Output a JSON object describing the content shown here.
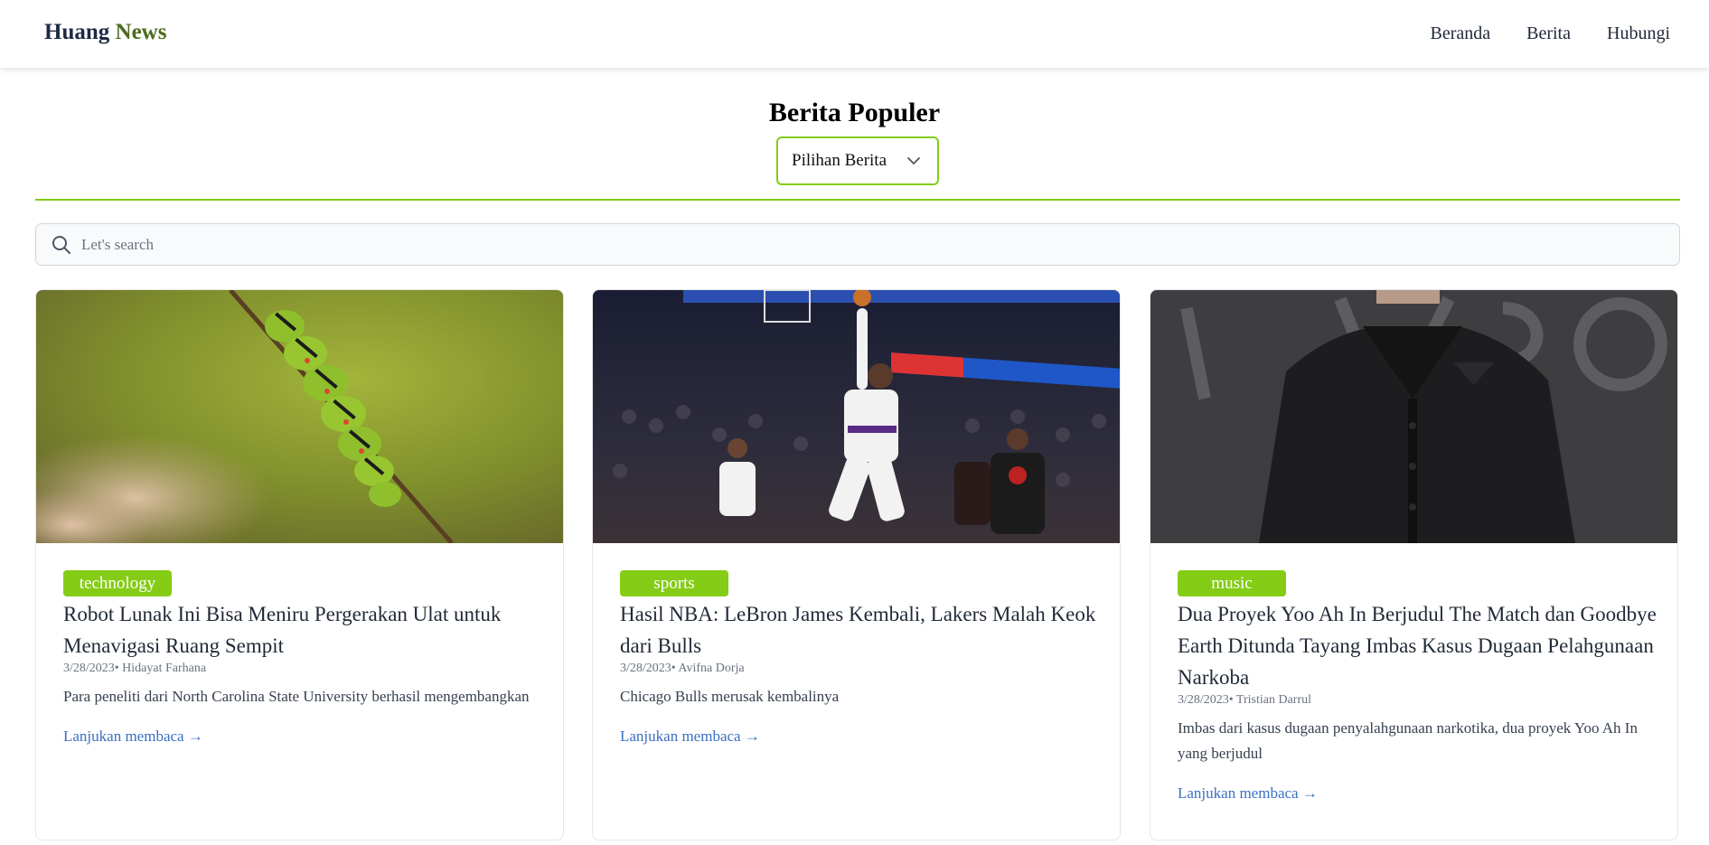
{
  "header": {
    "brand_first": "Huang",
    "brand_second": "News",
    "nav": [
      "Beranda",
      "Berita",
      "Hubungi"
    ]
  },
  "main": {
    "title": "Berita Populer",
    "filter": {
      "selected": "Pilihan Berita"
    },
    "search": {
      "placeholder": "Let's search",
      "value": ""
    }
  },
  "articles": [
    {
      "category": "technology",
      "title": "Robot Lunak Ini Bisa Meniru Pergerakan Ulat untuk Menavigasi Ruang Sempit",
      "meta": "3/28/2023• Hidayat Farhana",
      "excerpt": "Para peneliti dari North Carolina State University berhasil mengembangkan",
      "link": "Lanjukan membaca →",
      "image": "caterpillar-photo"
    },
    {
      "category": "sports",
      "title": "Hasil NBA: LeBron James Kembali, Lakers Malah Keok dari Bulls",
      "meta": "3/28/2023• Avifna Dorja",
      "excerpt": "Chicago Bulls merusak kembalinya",
      "link": "Lanjukan membaca →",
      "image": "basketball-photo"
    },
    {
      "category": "music",
      "title": "Dua Proyek Yoo Ah In Berjudul The Match dan Goodbye Earth Ditunda Tayang Imbas Kasus Dugaan Pelahgunaan Narkoba",
      "meta": "3/28/2023• Tristian Darrul",
      "excerpt": "Imbas dari kasus dugaan penyalahgunaan narkotika, dua proyek Yoo Ah In yang berjudul",
      "link": "Lanjukan membaca →",
      "image": "portrait-photo"
    }
  ],
  "colors": {
    "accent": "#84cc16",
    "link": "#3b6fc4",
    "brand_accent": "#4d6b1f"
  }
}
